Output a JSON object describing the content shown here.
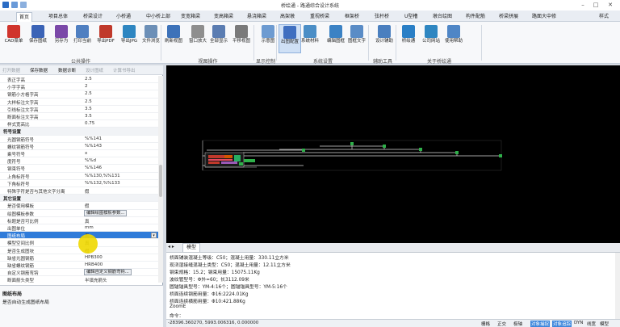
{
  "app": {
    "title": "桥绘通 - 路通综合设计系统"
  },
  "menu": {
    "tabs": [
      "首页",
      "项目总体",
      "桥梁设计",
      "小桥通",
      "中小桥上部",
      "变宽箱梁",
      "变高箱梁",
      "悬浇箱梁",
      "高架墩",
      "重视桥梁",
      "框架桥",
      "弦杆桥",
      "U型槽",
      "墩台绘图",
      "构件配筋",
      "桥梁拼展",
      "路面大中修"
    ],
    "style_label": "样式"
  },
  "ribbon": {
    "buttons": [
      "CAD菜单",
      "保存图纸",
      "另存为",
      "打印当前",
      "导出PDF",
      "导出JPG",
      "文件浏览",
      "刷新视图",
      "窗口放大",
      "全部显示",
      "平移视图",
      "示意图",
      "出图配置",
      "系统材料",
      "编辑图框",
      "图框文字",
      "设计辅助",
      "桥绘通",
      "公司网站",
      "使用帮助"
    ],
    "groups": [
      "公共操作",
      "视图操作",
      "显示控制",
      "系统设置",
      "辅助工具",
      "关于桥绘通"
    ]
  },
  "panel": {
    "toolbar": [
      "打开数据",
      "保存数据",
      "数据诊断",
      "设计图纸",
      "计算书导出"
    ],
    "properties": [
      {
        "name": "表正字高",
        "value": "2.5",
        "kind": "prop"
      },
      {
        "name": "小字字高",
        "value": "2",
        "kind": "prop"
      },
      {
        "name": "钢筋小方格字高",
        "value": "2.5",
        "kind": "prop"
      },
      {
        "name": "大样标注文字高",
        "value": "2.5",
        "kind": "prop"
      },
      {
        "name": "引线标注文字高",
        "value": "3.5",
        "kind": "prop"
      },
      {
        "name": "断面标注文字高",
        "value": "3.5",
        "kind": "prop"
      },
      {
        "name": "样式宽高比",
        "value": "0.75",
        "kind": "prop"
      },
      {
        "name": "符号设置",
        "value": "",
        "kind": "cat"
      },
      {
        "name": "光圆钢筋符号",
        "value": "%%141",
        "kind": "prop"
      },
      {
        "name": "螺纹钢筋符号",
        "value": "%%143",
        "kind": "prop"
      },
      {
        "name": "乘号符号",
        "value": "x",
        "kind": "prop"
      },
      {
        "name": "度符号",
        "value": "%%d",
        "kind": "prop"
      },
      {
        "name": "钢束符号",
        "value": "%%146",
        "kind": "prop"
      },
      {
        "name": "上角标符号",
        "value": "%%130,%%131",
        "kind": "prop"
      },
      {
        "name": "下角标符号",
        "value": "%%132,%%133",
        "kind": "prop"
      },
      {
        "name": "特殊字符是否与其他文字分离",
        "value": "假",
        "kind": "prop"
      },
      {
        "name": "其它设置",
        "value": "",
        "kind": "cat"
      },
      {
        "name": "是否使用模板",
        "value": "假",
        "kind": "prop"
      },
      {
        "name": "绘图模板参数",
        "value": "编辑绘图模板参数...",
        "kind": "btn"
      },
      {
        "name": "标题是否可比例",
        "value": "真",
        "kind": "prop"
      },
      {
        "name": "出图单位",
        "value": "mm",
        "kind": "prop"
      },
      {
        "name": "图纸布局",
        "value": "真",
        "kind": "sel"
      },
      {
        "name": "模型空间比例",
        "value": "真",
        "kind": "prop"
      },
      {
        "name": "是否生成图块",
        "value": "假",
        "kind": "prop"
      },
      {
        "name": "缺省光圆钢筋",
        "value": "HPB300",
        "kind": "prop"
      },
      {
        "name": "缺省螺纹钢筋",
        "value": "HRB400",
        "kind": "prop"
      },
      {
        "name": "自定义钢筋弯钩",
        "value": "编辑自定义钢筋弯钩...",
        "kind": "btn"
      },
      {
        "name": "断面箭头类型",
        "value": "半填充箭头",
        "kind": "prop"
      }
    ],
    "description": {
      "title": "图纸布局",
      "text": "是否自动生成图纸布局"
    }
  },
  "viewport": {
    "tab_label": "模型"
  },
  "command": {
    "lines": [
      "桥面铺装混凝土等级：C50；混凝土用量：330.11立方米",
      "现浇湿接缝混凝土类型：C50；混凝土用量：12.11立方米",
      "钢束规格：15.2；钢束用量：15075.11Kg",
      "波纹管型号：Φ外=60；长3112.09米",
      "圆锚锚具型号：YM-4:16个；圆锚锚具型号：YM-5:16个",
      "桥面连续钢筋用量：Φ16:2224.01Kg",
      "桥面连续横筋用量：Φ10:421.88Kg",
      "ZoomE",
      "命令："
    ]
  },
  "status": {
    "coords": "-28396.360270, 5993.006316, 0.000000",
    "toggles": [
      "栅格",
      "正交",
      "极轴",
      "对象捕捉",
      "对象追踪",
      "DYN",
      "线宽",
      "模型"
    ],
    "active": [
      "对象捕捉",
      "对象追踪"
    ]
  },
  "colors": {
    "selection": "#2f7bd9",
    "viewport_bg": "#000000",
    "cursor_marker": "#f0d800"
  }
}
